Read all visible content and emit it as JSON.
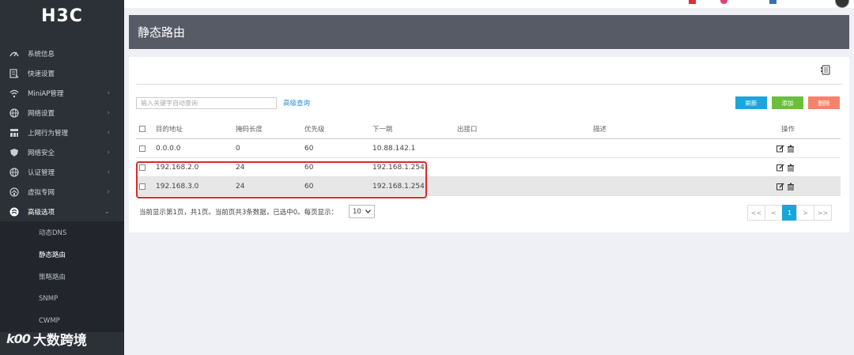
{
  "brand": {
    "logo_text": "H3C"
  },
  "sidebar": {
    "items": [
      {
        "icon": "speedometer-icon",
        "label": "系统信息",
        "has_arrow": false
      },
      {
        "icon": "quick-setup-icon",
        "label": "快速设置",
        "has_arrow": false
      },
      {
        "icon": "wifi-icon",
        "label": "MiniAP管理",
        "has_arrow": true
      },
      {
        "icon": "globe-icon",
        "label": "网络设置",
        "has_arrow": true
      },
      {
        "icon": "behavior-icon",
        "label": "上网行为管理",
        "has_arrow": true
      },
      {
        "icon": "shield-icon",
        "label": "网络安全",
        "has_arrow": true
      },
      {
        "icon": "globe-icon",
        "label": "认证管理",
        "has_arrow": true
      },
      {
        "icon": "vpn-icon",
        "label": "虚拟专网",
        "has_arrow": true
      },
      {
        "icon": "advanced-icon",
        "label": "高级选项",
        "has_arrow": true,
        "expanded": true
      }
    ],
    "submenu": [
      {
        "label": "动态DNS",
        "active": false
      },
      {
        "label": "静态路由",
        "active": true
      },
      {
        "label": "策略路由",
        "active": false
      },
      {
        "label": "SNMP",
        "active": false
      },
      {
        "label": "CWMP",
        "active": false
      }
    ],
    "watermark": {
      "logo": "k00",
      "text": "大数跨境"
    }
  },
  "header": {
    "title": "静态路由"
  },
  "toolbar": {
    "search_placeholder": "输入关键字自动查询",
    "advanced_query": "高级查询",
    "refresh": "刷新",
    "add": "添加",
    "delete": "删除"
  },
  "table": {
    "headers": {
      "dest": "目的地址",
      "mask": "掩码长度",
      "priority": "优先级",
      "next_hop": "下一跳",
      "out_iface": "出接口",
      "desc": "描述",
      "ops": "操作"
    },
    "rows": [
      {
        "dest": "0.0.0.0",
        "mask": "0",
        "priority": "60",
        "next_hop": "10.88.142.1",
        "out_iface": "",
        "desc": ""
      },
      {
        "dest": "192.168.2.0",
        "mask": "24",
        "priority": "60",
        "next_hop": "192.168.1.254",
        "out_iface": "",
        "desc": ""
      },
      {
        "dest": "192.168.3.0",
        "mask": "24",
        "priority": "60",
        "next_hop": "192.168.1.254",
        "out_iface": "",
        "desc": ""
      }
    ]
  },
  "footer": {
    "info": "当前显示第1页，共1页。当前页共3条数据，已选中0。每页显示：",
    "page_size": "10",
    "pager": {
      "first": "<<",
      "prev": "<",
      "current": "1",
      "next": ">",
      "last": ">>"
    }
  },
  "colors": {
    "sidebar_bg": "#2c3138",
    "header_bg": "#575b66",
    "refresh": "#1ba6d8",
    "add": "#6bbf3e",
    "delete": "#f5836a",
    "highlight": "#e2242b"
  }
}
